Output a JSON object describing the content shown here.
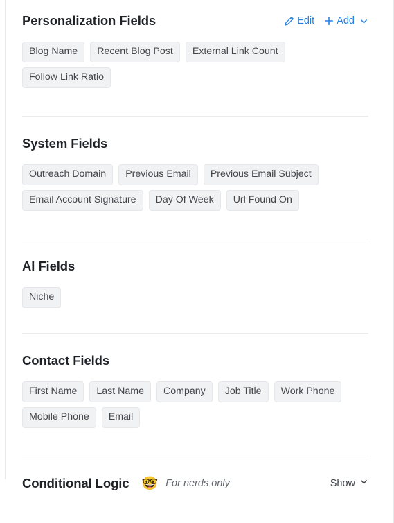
{
  "panel": {
    "sections": [
      {
        "id": "personalization-fields",
        "title": "Personalization Fields",
        "actions": {
          "edit_label": "Edit",
          "add_label": "Add"
        },
        "chips": [
          "Blog Name",
          "Recent Blog Post",
          "External Link Count",
          "Follow Link Ratio"
        ]
      },
      {
        "id": "system-fields",
        "title": "System Fields",
        "chips": [
          "Outreach Domain",
          "Previous Email",
          "Previous Email Subject",
          "Email Account Signature",
          "Day Of Week",
          "Url Found On"
        ]
      },
      {
        "id": "ai-fields",
        "title": "AI Fields",
        "chips": [
          "Niche"
        ]
      },
      {
        "id": "contact-fields",
        "title": "Contact Fields",
        "chips": [
          "First Name",
          "Last Name",
          "Company",
          "Job Title",
          "Work Phone",
          "Mobile Phone",
          "Email"
        ]
      }
    ],
    "conditional_logic": {
      "title": "Conditional Logic",
      "emoji": "🤓",
      "emoji_name": "nerd-face-emoji",
      "note": "For nerds only",
      "toggle_label": "Show"
    },
    "colors": {
      "link": "#2481e0",
      "chip_bg": "#f1f2f4",
      "chip_text": "#43464b",
      "heading": "#1f2328",
      "divider": "#ececee",
      "note_text": "#62666d"
    },
    "icons": {
      "edit": "pencil-icon",
      "add": "plus-icon",
      "add_caret": "chevron-down-icon",
      "show_caret": "chevron-down-icon"
    }
  }
}
